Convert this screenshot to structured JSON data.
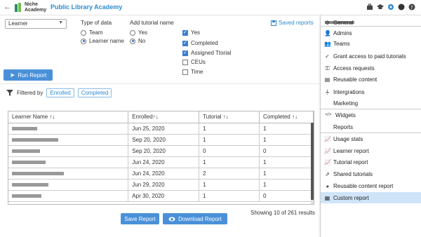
{
  "app": {
    "brand": "Niche Academy",
    "title": "Public Library Academy"
  },
  "filters": {
    "report_select": "Learner",
    "type_of_data": {
      "title": "Type of data",
      "options": [
        {
          "label": "Team",
          "selected": false
        },
        {
          "label": "Learner name",
          "selected": true
        }
      ]
    },
    "add_tutorial_name": {
      "title": "Add tutorial name",
      "options": [
        {
          "label": "Yes",
          "selected": false
        },
        {
          "label": "No",
          "selected": true
        }
      ]
    },
    "columns": [
      {
        "label": "Yes",
        "checked": true
      },
      {
        "label": "Completed",
        "checked": true
      },
      {
        "label": "Assigned Ttorial",
        "checked": true
      },
      {
        "label": "CEUs",
        "checked": false
      },
      {
        "label": "Time",
        "checked": false
      }
    ],
    "saved_reports": "Saved reports",
    "run_report": "Run Report",
    "filtered_by": "Filtered by",
    "chips": [
      "Enrolled",
      "Completed"
    ]
  },
  "table": {
    "headers": [
      "Learner Name ↑↓",
      "Enrolled↑↓",
      "Tutorial ↑↓",
      "Completed ↑↓"
    ],
    "rows": [
      {
        "name_len": 0.36,
        "enrolled": "Jun 25, 2020",
        "tutorial": "1",
        "completed": "1"
      },
      {
        "name_len": 0.66,
        "enrolled": "Sep 20, 2020",
        "tutorial": "1",
        "completed": "1"
      },
      {
        "name_len": 0.4,
        "enrolled": "Sep 20, 2020",
        "tutorial": "0",
        "completed": "0"
      },
      {
        "name_len": 0.48,
        "enrolled": "Jun 24, 2020",
        "tutorial": "1",
        "completed": "1"
      },
      {
        "name_len": 0.74,
        "enrolled": "Jun 24, 2020",
        "tutorial": "2",
        "completed": "1"
      },
      {
        "name_len": 0.52,
        "enrolled": "Jun 29, 2020",
        "tutorial": "1",
        "completed": "1"
      },
      {
        "name_len": 0.42,
        "enrolled": "Apr 30, 2020",
        "tutorial": "1",
        "completed": "0"
      }
    ],
    "showing": "Showing 10 of 261 results"
  },
  "actions": {
    "save_report": "Save Report",
    "download_report": "Download Report"
  },
  "panel": {
    "items": [
      {
        "label": "General",
        "icon": "gear-icon"
      },
      {
        "label": "Admins",
        "icon": "person-icon"
      },
      {
        "label": "Teams",
        "icon": "team-icon"
      },
      {
        "label": "Grant access to paid tutorials",
        "icon": "check-icon"
      },
      {
        "label": "Access requests",
        "icon": "key-icon"
      },
      {
        "label": "Reusable content",
        "icon": "page-icon"
      },
      {
        "label": "Intergrations",
        "icon": "plug-icon"
      },
      {
        "label": "Marketing",
        "icon": ""
      },
      {
        "label": "Widgets",
        "icon": "code-icon"
      },
      {
        "label": "Reports",
        "icon": ""
      },
      {
        "label": "Usage stats",
        "icon": "chart-icon"
      },
      {
        "label": "Learner report",
        "icon": "chart-icon"
      },
      {
        "label": "Tutorial report",
        "icon": "chart-icon"
      },
      {
        "label": "Shared tutorials",
        "icon": "share-icon"
      },
      {
        "label": "Reusable content report",
        "icon": "pie-icon"
      },
      {
        "label": "Custom report",
        "icon": "grid-icon"
      }
    ]
  },
  "colors": {
    "accent": "#2c8bd0",
    "button": "#4a90d9",
    "active_row": "#cfe4f8"
  }
}
